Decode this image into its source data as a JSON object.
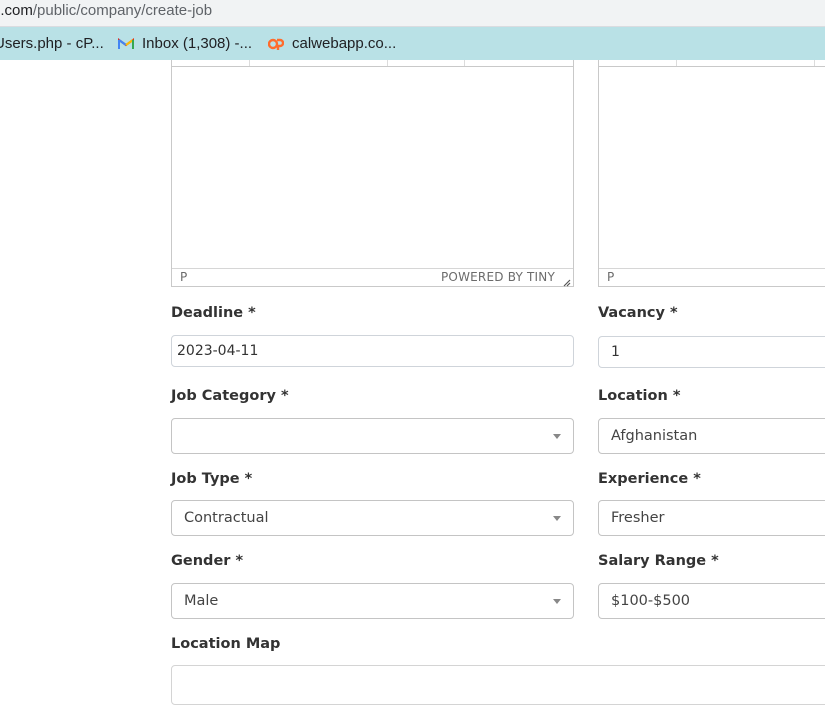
{
  "browser": {
    "url_host": "n.com",
    "url_path": "/public/company/create-job",
    "bookmarks": [
      {
        "label": "Users.php - cP...",
        "icon": "cpanel-icon"
      },
      {
        "label": "Inbox (1,308) -...",
        "icon": "gmail-icon"
      },
      {
        "label": "calwebapp.co...",
        "icon": "cpanel-icon"
      }
    ]
  },
  "editors": {
    "left": {
      "path": "P",
      "branding": "POWERED BY TINY"
    },
    "right": {
      "path": "P"
    }
  },
  "form": {
    "deadline": {
      "label": "Deadline *",
      "value": "2023-04-11"
    },
    "vacancy": {
      "label": "Vacancy *",
      "value": "1"
    },
    "job_category": {
      "label": "Job Category *",
      "value": ""
    },
    "location": {
      "label": "Location *",
      "value": "Afghanistan"
    },
    "job_type": {
      "label": "Job Type *",
      "value": "Contractual"
    },
    "experience": {
      "label": "Experience *",
      "value": "Fresher"
    },
    "gender": {
      "label": "Gender *",
      "value": "Male"
    },
    "salary_range": {
      "label": "Salary Range *",
      "value": "$100-$500"
    },
    "location_map": {
      "label": "Location Map"
    }
  },
  "colors": {
    "bookmarks_bar": "#b9e1e6",
    "address_bar": "#f1f3f4",
    "input_border": "#cfd4da"
  }
}
